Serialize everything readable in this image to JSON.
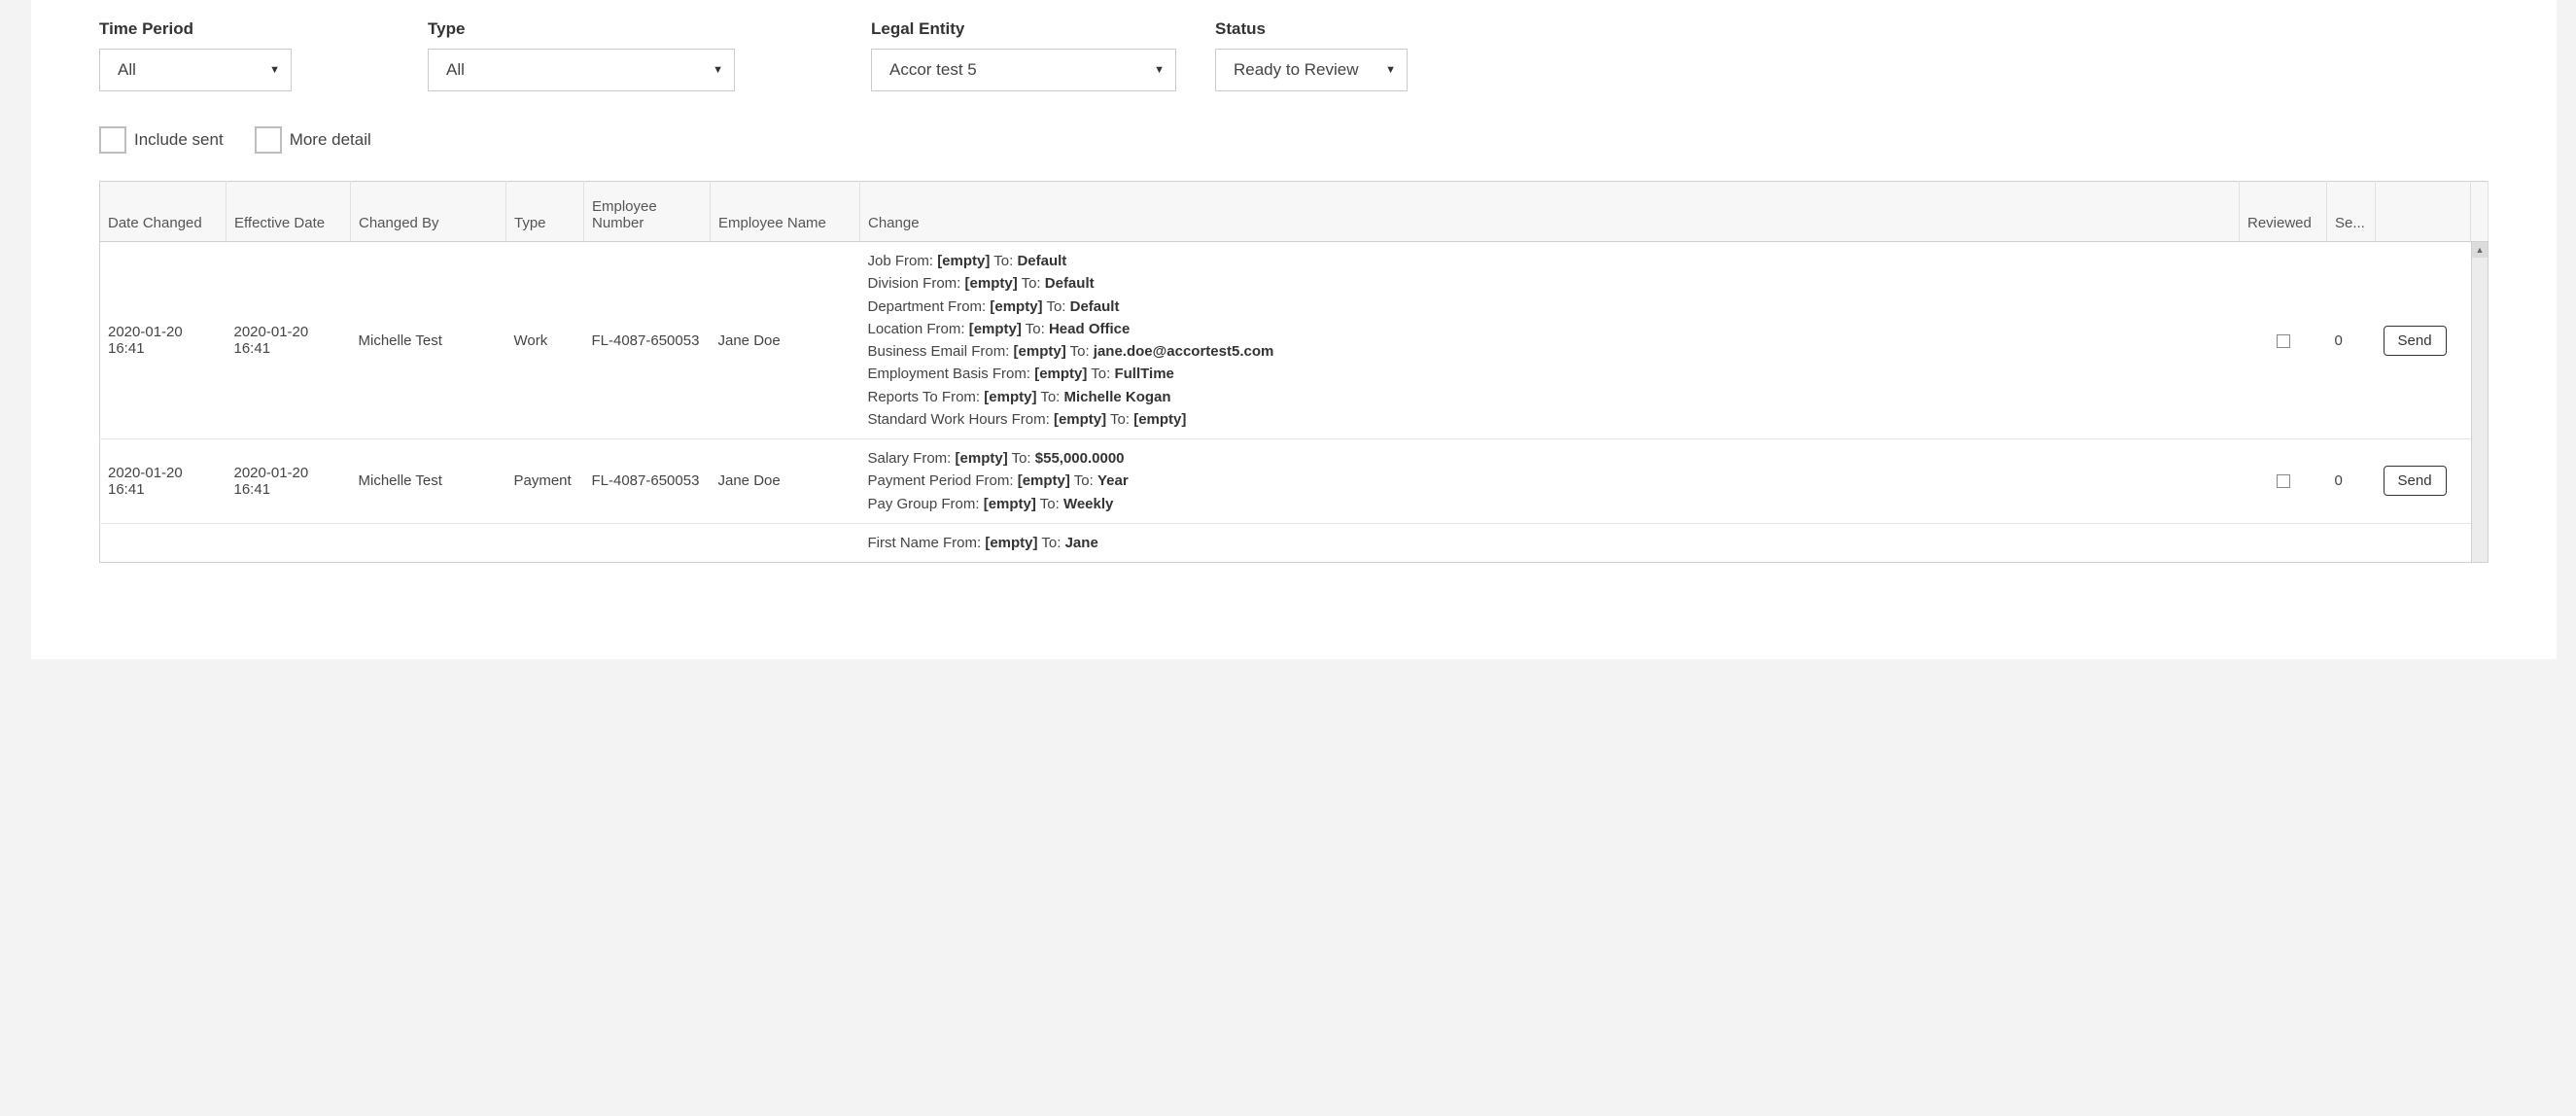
{
  "filters": {
    "time_period": {
      "label": "Time Period",
      "value": "All"
    },
    "type": {
      "label": "Type",
      "value": "All"
    },
    "legal_entity": {
      "label": "Legal Entity",
      "value": "Accor test 5"
    },
    "status": {
      "label": "Status",
      "value": "Ready to Review"
    }
  },
  "checkboxes": {
    "include_sent": {
      "label": "Include sent",
      "checked": false
    },
    "more_detail": {
      "label": "More detail",
      "checked": false
    }
  },
  "table": {
    "headers": {
      "date_changed": "Date Changed",
      "effective_date": "Effective Date",
      "changed_by": "Changed By",
      "type": "Type",
      "employee_number": "Employee Number",
      "employee_name": "Employee Name",
      "change": "Change",
      "reviewed": "Reviewed",
      "sent": "Se...",
      "action": ""
    },
    "rows": [
      {
        "date_changed": "2020-01-20 16:41",
        "effective_date": "2020-01-20 16:41",
        "changed_by": "Michelle Test",
        "type": "Work",
        "employee_number": "FL-4087-650053",
        "employee_name": "Jane Doe",
        "changes": [
          {
            "field": "Job",
            "from": "[empty]",
            "to": "Default"
          },
          {
            "field": "Division",
            "from": "[empty]",
            "to": "Default"
          },
          {
            "field": "Department",
            "from": "[empty]",
            "to": "Default"
          },
          {
            "field": "Location",
            "from": "[empty]",
            "to": "Head Office"
          },
          {
            "field": "Business Email",
            "from": "[empty]",
            "to": "jane.doe@accortest5.com"
          },
          {
            "field": "Employment Basis",
            "from": "[empty]",
            "to": "FullTime"
          },
          {
            "field": "Reports To",
            "from": "[empty]",
            "to": "Michelle Kogan"
          },
          {
            "field": "Standard Work Hours",
            "from": "[empty]",
            "to": "[empty]"
          }
        ],
        "reviewed": false,
        "sent": "0",
        "action_label": "Send"
      },
      {
        "date_changed": "2020-01-20 16:41",
        "effective_date": "2020-01-20 16:41",
        "changed_by": "Michelle Test",
        "type": "Payment",
        "employee_number": "FL-4087-650053",
        "employee_name": "Jane Doe",
        "changes": [
          {
            "field": "Salary",
            "from": "[empty]",
            "to": "$55,000.0000"
          },
          {
            "field": "Payment Period",
            "from": "[empty]",
            "to": "Year"
          },
          {
            "field": "Pay Group",
            "from": "[empty]",
            "to": "Weekly"
          }
        ],
        "reviewed": false,
        "sent": "0",
        "action_label": "Send"
      },
      {
        "date_changed": "",
        "effective_date": "",
        "changed_by": "",
        "type": "",
        "employee_number": "",
        "employee_name": "",
        "changes": [
          {
            "field": "First Name",
            "from": "[empty]",
            "to": "Jane"
          }
        ],
        "reviewed": false,
        "sent": "",
        "action_label": ""
      }
    ]
  }
}
